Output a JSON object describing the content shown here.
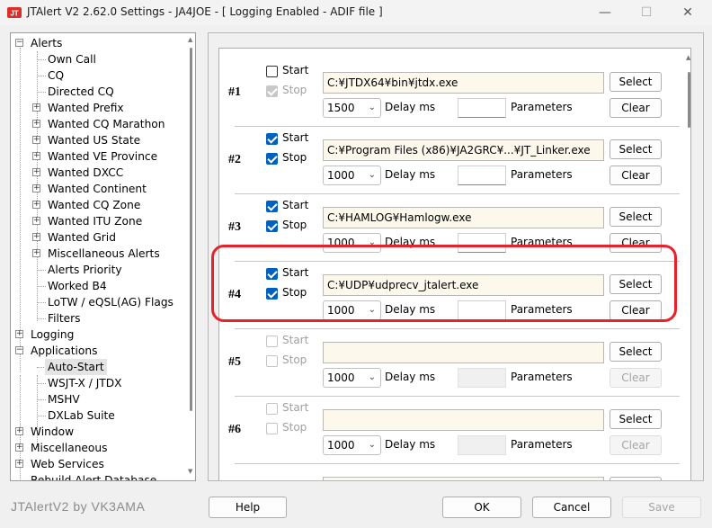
{
  "window": {
    "title": "JTAlert V2  2.62.0 Settings  -  JA4JOE  -  [ Logging Enabled - ADIF file ]",
    "min_glyph": "—",
    "max_glyph": "☐",
    "close_glyph": "✕"
  },
  "tree": {
    "items": [
      {
        "label": "Alerts",
        "level": 0,
        "expander": "−"
      },
      {
        "label": "Own Call",
        "level": 1,
        "expander": ""
      },
      {
        "label": "CQ",
        "level": 1,
        "expander": ""
      },
      {
        "label": "Directed CQ",
        "level": 1,
        "expander": ""
      },
      {
        "label": "Wanted Prefix",
        "level": 1,
        "expander": "+"
      },
      {
        "label": "Wanted CQ Marathon",
        "level": 1,
        "expander": "+"
      },
      {
        "label": "Wanted US State",
        "level": 1,
        "expander": "+"
      },
      {
        "label": "Wanted VE Province",
        "level": 1,
        "expander": "+"
      },
      {
        "label": "Wanted DXCC",
        "level": 1,
        "expander": "+"
      },
      {
        "label": "Wanted Continent",
        "level": 1,
        "expander": "+"
      },
      {
        "label": "Wanted CQ Zone",
        "level": 1,
        "expander": "+"
      },
      {
        "label": "Wanted ITU Zone",
        "level": 1,
        "expander": "+"
      },
      {
        "label": "Wanted Grid",
        "level": 1,
        "expander": "+"
      },
      {
        "label": "Miscellaneous Alerts",
        "level": 1,
        "expander": "+"
      },
      {
        "label": "Alerts Priority",
        "level": 1,
        "expander": ""
      },
      {
        "label": "Worked B4",
        "level": 1,
        "expander": ""
      },
      {
        "label": "LoTW / eQSL(AG) Flags",
        "level": 1,
        "expander": ""
      },
      {
        "label": "Filters",
        "level": 1,
        "expander": ""
      },
      {
        "label": "Logging",
        "level": 0,
        "expander": "+"
      },
      {
        "label": "Applications",
        "level": 0,
        "expander": "−"
      },
      {
        "label": "Auto-Start",
        "level": 1,
        "expander": "",
        "selected": true
      },
      {
        "label": "WSJT-X / JTDX",
        "level": 1,
        "expander": ""
      },
      {
        "label": "MSHV",
        "level": 1,
        "expander": ""
      },
      {
        "label": "DXLab Suite",
        "level": 1,
        "expander": ""
      },
      {
        "label": "Window",
        "level": 0,
        "expander": "+"
      },
      {
        "label": "Miscellaneous",
        "level": 0,
        "expander": "+"
      },
      {
        "label": "Web Services",
        "level": 0,
        "expander": "+"
      },
      {
        "label": "Rebuild Alert Database",
        "level": 0,
        "expander": ""
      }
    ]
  },
  "autostart": {
    "start_label": "Start",
    "stop_label": "Stop",
    "select_label": "Select",
    "clear_label": "Clear",
    "delay_label": "Delay ms",
    "params_label": "Parameters",
    "entries": [
      {
        "num": "#1",
        "start": false,
        "stop": true,
        "stop_disabled": true,
        "start_disabled": false,
        "path": "C:¥JTDX64¥bin¥jtdx.exe",
        "delay": "1500",
        "params": "",
        "params_disabled": false,
        "clear_disabled": false
      },
      {
        "num": "#2",
        "start": true,
        "stop": true,
        "stop_disabled": false,
        "start_disabled": false,
        "path": "C:¥Program Files (x86)¥JA2GRC¥...¥JT_Linker.exe",
        "delay": "1000",
        "params": "",
        "params_disabled": false,
        "clear_disabled": false
      },
      {
        "num": "#3",
        "start": true,
        "stop": true,
        "stop_disabled": false,
        "start_disabled": false,
        "path": "C:¥HAMLOG¥Hamlogw.exe",
        "delay": "1000",
        "params": "",
        "params_disabled": false,
        "clear_disabled": false
      },
      {
        "num": "#4",
        "start": true,
        "stop": true,
        "stop_disabled": false,
        "start_disabled": false,
        "path": "C:¥UDP¥udprecv_jtalert.exe",
        "delay": "1000",
        "params": "",
        "params_disabled": false,
        "clear_disabled": false
      },
      {
        "num": "#5",
        "start": false,
        "stop": false,
        "stop_disabled": true,
        "start_disabled": true,
        "path": "",
        "delay": "1000",
        "params": "",
        "params_disabled": true,
        "clear_disabled": true
      },
      {
        "num": "#6",
        "start": false,
        "stop": false,
        "stop_disabled": true,
        "start_disabled": true,
        "path": "",
        "delay": "1000",
        "params": "",
        "params_disabled": true,
        "clear_disabled": true
      },
      {
        "num": "",
        "start": false,
        "stop": false,
        "stop_disabled": true,
        "start_disabled": true,
        "path": "",
        "delay": "",
        "params": "",
        "params_disabled": true,
        "clear_disabled": true
      }
    ]
  },
  "footer": {
    "credit": "JTAlertV2 by VK3AMA",
    "help_label": "Help",
    "ok_label": "OK",
    "cancel_label": "Cancel",
    "save_label": "Save"
  },
  "colors": {
    "highlight": "#e8222a",
    "checkbox_on": "#0060c0",
    "path_bg": "#fdf8ec"
  }
}
